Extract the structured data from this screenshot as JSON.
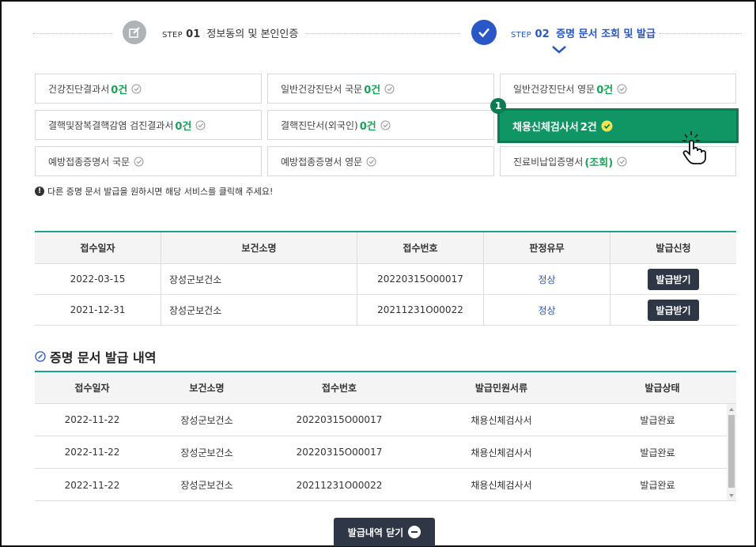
{
  "steps": [
    {
      "prefix": "STEP",
      "num": "01",
      "label": "정보동의 및 본인인증",
      "state": "done"
    },
    {
      "prefix": "STEP",
      "num": "02",
      "label": "증명 문서 조회 및 발급",
      "state": "current"
    }
  ],
  "documents": [
    {
      "label": "건강진단결과서",
      "count": "0건"
    },
    {
      "label": "일반건강진단서 국문",
      "count": "0건"
    },
    {
      "label": "일반건강진단서 영문",
      "count": "0건"
    },
    {
      "label": "결핵및잠복결핵감염 검진결과서",
      "count": "0건"
    },
    {
      "label": "결핵진단서(외국인)",
      "count": "0건"
    },
    {
      "label": "채용신체검사서",
      "count": "2건",
      "selected": true
    },
    {
      "label": "예방접종증명서 국문",
      "count": ""
    },
    {
      "label": "예방접종증명서 영문",
      "count": ""
    },
    {
      "label": "진료비납입증명서",
      "count": "(조회)"
    }
  ],
  "callout_number": "1",
  "notice": "다른 증명 문서 발급을 원하시면 해당 서비스를 클릭해 주세요!",
  "receipts": {
    "columns": [
      "접수일자",
      "보건소명",
      "접수번호",
      "판정유무",
      "발급신청"
    ],
    "rows": [
      {
        "date": "2022-03-15",
        "center": "장성군보건소",
        "receipt_no": "20220315O00017",
        "result": "정상",
        "action": "발급받기"
      },
      {
        "date": "2021-12-31",
        "center": "장성군보건소",
        "receipt_no": "20211231O00022",
        "result": "정상",
        "action": "발급받기"
      }
    ]
  },
  "history": {
    "title": "증명 문서 발급 내역",
    "columns": [
      "접수일자",
      "보건소명",
      "접수번호",
      "발급민원서류",
      "발급상태"
    ],
    "rows": [
      {
        "date": "2022-11-22",
        "center": "장성군보건소",
        "receipt_no": "20220315O00017",
        "doc": "채용신체검사서",
        "status": "발급완료"
      },
      {
        "date": "2022-11-22",
        "center": "장성군보건소",
        "receipt_no": "20220315O00017",
        "doc": "채용신체검사서",
        "status": "발급완료"
      },
      {
        "date": "2022-11-22",
        "center": "장성군보건소",
        "receipt_no": "20211231O00022",
        "doc": "채용신체검사서",
        "status": "발급완료"
      }
    ]
  },
  "close_button": "발급내역 닫기",
  "colors": {
    "accent_green": "#109665",
    "step_blue": "#2a57c7",
    "dark_button": "#2f3747",
    "table_top": "#1aa38f"
  },
  "icons": {
    "step1": "edit-icon",
    "step2": "check-icon",
    "cursor": "hand-pointer-icon"
  }
}
